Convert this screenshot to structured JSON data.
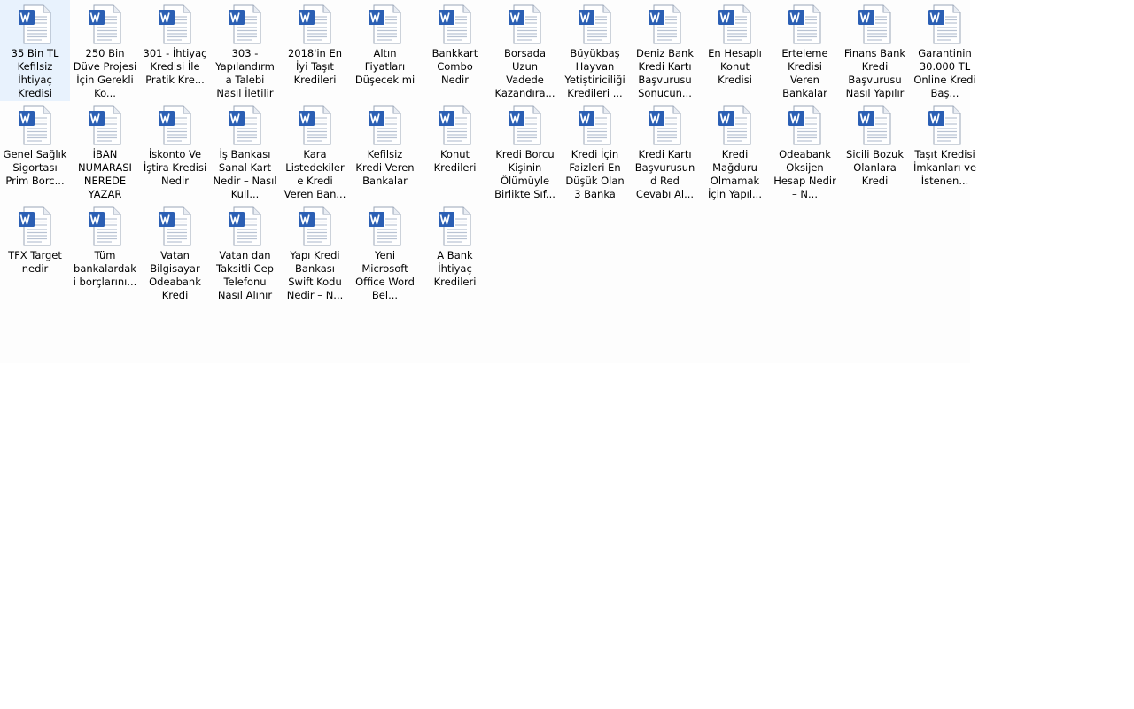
{
  "desktop": {
    "files": [
      {
        "label": "35 Bin TL Kefilsiz İhtiyaç Kredisi",
        "icon": "word-document-icon"
      },
      {
        "label": "250 Bin Düve Projesi İçin Gerekli Ko...",
        "icon": "word-document-icon"
      },
      {
        "label": "301 - İhtiyaç Kredisi İle Pratik Kre...",
        "icon": "word-document-icon"
      },
      {
        "label": "303 - Yapılandırma Talebi Nasıl İletilir",
        "icon": "word-document-icon"
      },
      {
        "label": "2018'in En İyi Taşıt Kredileri",
        "icon": "word-document-icon"
      },
      {
        "label": "Altın Fiyatları Düşecek mi",
        "icon": "word-document-icon"
      },
      {
        "label": "Bankkart Combo Nedir",
        "icon": "word-document-icon"
      },
      {
        "label": "Borsada Uzun Vadede Kazandıra...",
        "icon": "word-document-icon"
      },
      {
        "label": "Büyükbaş Hayvan Yetiştiriciliği Kredileri ...",
        "icon": "word-document-icon"
      },
      {
        "label": "Deniz Bank Kredi Kartı Başvurusu Sonucun...",
        "icon": "word-document-icon"
      },
      {
        "label": "En Hesaplı Konut Kredisi",
        "icon": "word-document-icon"
      },
      {
        "label": "Erteleme Kredisi Veren Bankalar",
        "icon": "word-document-icon"
      },
      {
        "label": "Finans Bank Kredi Başvurusu Nasıl Yapılır",
        "icon": "word-document-icon"
      },
      {
        "label": "Garantinin 30.000 TL Online Kredi Baş...",
        "icon": "word-document-icon"
      },
      {
        "label": "Genel Sağlık Sigortası Prim Borc...",
        "icon": "word-document-icon"
      },
      {
        "label": "İBAN NUMARASI NEREDE YAZAR",
        "icon": "word-document-icon"
      },
      {
        "label": "İskonto Ve İştira Kredisi Nedir",
        "icon": "word-document-icon"
      },
      {
        "label": "İş Bankası Sanal Kart Nedir – Nasıl Kull...",
        "icon": "word-document-icon"
      },
      {
        "label": "Kara Listedekilere Kredi Veren Ban...",
        "icon": "word-document-icon"
      },
      {
        "label": "Kefilsiz Kredi Veren Bankalar",
        "icon": "word-document-icon"
      },
      {
        "label": "Konut Kredileri",
        "icon": "word-document-icon"
      },
      {
        "label": "Kredi Borcu Kişinin Ölümüyle Birlikte Sıf...",
        "icon": "word-document-icon"
      },
      {
        "label": "Kredi İçin Faizleri En Düşük Olan 3 Banka",
        "icon": "word-document-icon"
      },
      {
        "label": "Kredi Kartı Başvurusund Red Cevabı Al...",
        "icon": "word-document-icon"
      },
      {
        "label": "Kredi Mağduru Olmamak İçin Yapıl...",
        "icon": "word-document-icon"
      },
      {
        "label": "Odeabank Oksijen Hesap Nedir – N...",
        "icon": "word-document-icon"
      },
      {
        "label": "Sicili Bozuk Olanlara Kredi",
        "icon": "word-document-icon"
      },
      {
        "label": "Taşıt Kredisi İmkanları ve İstenen...",
        "icon": "word-document-icon"
      },
      {
        "label": "TFX Target nedir",
        "icon": "word-document-icon"
      },
      {
        "label": "Tüm bankalardaki borçlarını...",
        "icon": "word-document-icon"
      },
      {
        "label": "Vatan Bilgisayar Odeabank Kredi",
        "icon": "word-document-icon"
      },
      {
        "label": "Vatan dan Taksitli Cep Telefonu Nasıl Alınır",
        "icon": "word-document-icon"
      },
      {
        "label": "Yapı Kredi Bankası Swift Kodu Nedir – N...",
        "icon": "word-document-icon"
      },
      {
        "label": "Yeni Microsoft Office Word Bel...",
        "icon": "word-document-icon"
      },
      {
        "label": "A Bank İhtiyaç Kredileri",
        "icon": "word-document-icon"
      }
    ],
    "colors": {
      "word_blue": "#2b5fb4",
      "page_white": "#ffffff",
      "page_border": "#9aa6b8",
      "line_gray": "#b9c3d3"
    }
  }
}
